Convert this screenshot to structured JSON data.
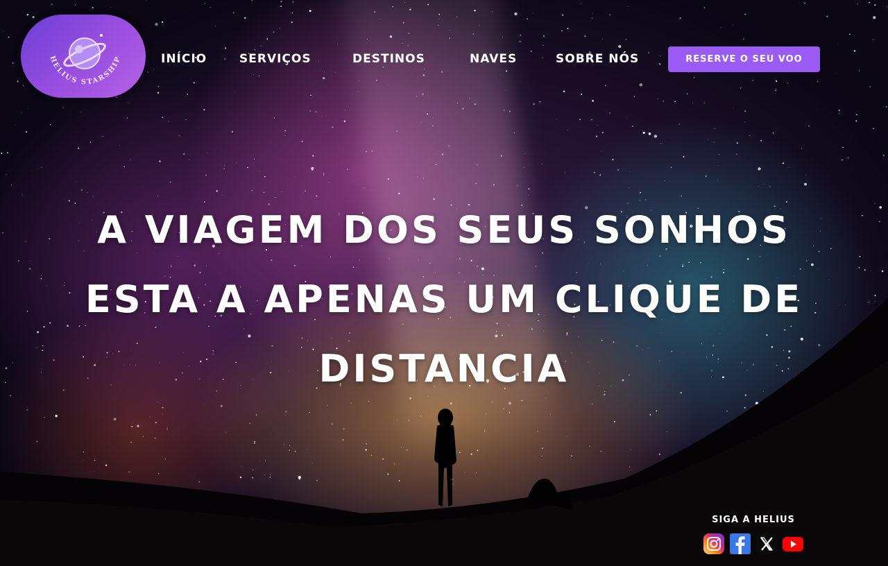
{
  "brand": {
    "logo_text": "HELIUS STARSHIP",
    "colors": {
      "accent": "#9b5cf6",
      "logo_bg": "#7c4ae0"
    }
  },
  "nav": {
    "items": [
      {
        "label": "Início"
      },
      {
        "label": "Serviços"
      },
      {
        "label": "Destinos"
      },
      {
        "label": "Naves"
      },
      {
        "label": "Sobre Nós"
      }
    ],
    "cta_label": "Reserve o seu voo"
  },
  "hero": {
    "title": "A viagem dos seus sonhos esta a apenas um clique de distancia"
  },
  "social": {
    "label": "Siga a Helius",
    "icons": [
      "instagram-icon",
      "facebook-icon",
      "x-icon",
      "youtube-icon"
    ]
  }
}
